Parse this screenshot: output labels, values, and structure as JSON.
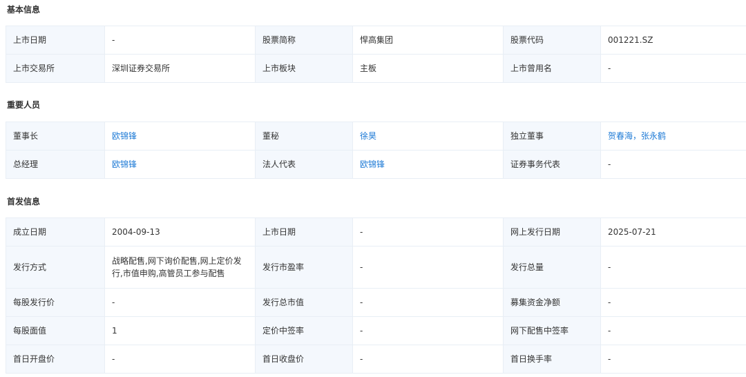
{
  "sections": {
    "basic": {
      "title": "基本信息",
      "rows": [
        [
          {
            "label": "上市日期",
            "value": "-"
          },
          {
            "label": "股票简称",
            "value": "悍高集团"
          },
          {
            "label": "股票代码",
            "value": "001221.SZ"
          }
        ],
        [
          {
            "label": "上市交易所",
            "value": "深圳证券交易所"
          },
          {
            "label": "上市板块",
            "value": "主板"
          },
          {
            "label": "上市曾用名",
            "value": "-"
          }
        ]
      ]
    },
    "people": {
      "title": "重要人员",
      "rows": [
        [
          {
            "label": "董事长",
            "value": "欧锦锋"
          },
          {
            "label": "董秘",
            "value": "徐昊"
          },
          {
            "label": "独立董事",
            "value": "贺春海，张永鹤"
          }
        ],
        [
          {
            "label": "总经理",
            "value": "欧锦锋"
          },
          {
            "label": "法人代表",
            "value": "欧锦锋"
          },
          {
            "label": "证券事务代表",
            "value": "-"
          }
        ]
      ]
    },
    "ipo": {
      "title": "首发信息",
      "rows": [
        [
          {
            "label": "成立日期",
            "value": "2004-09-13"
          },
          {
            "label": "上市日期",
            "value": "-"
          },
          {
            "label": "网上发行日期",
            "value": "2025-07-21"
          }
        ],
        [
          {
            "label": "发行方式",
            "value": "战略配售,网下询价配售,网上定价发行,市值申购,高管员工参与配售"
          },
          {
            "label": "发行市盈率",
            "value": "-"
          },
          {
            "label": "发行总量",
            "value": "-"
          }
        ],
        [
          {
            "label": "每股发行价",
            "value": "-"
          },
          {
            "label": "发行总市值",
            "value": "-"
          },
          {
            "label": "募集资金净额",
            "value": "-"
          }
        ],
        [
          {
            "label": "每股面值",
            "value": "1"
          },
          {
            "label": "定价中签率",
            "value": "-"
          },
          {
            "label": "网下配售中签率",
            "value": "-"
          }
        ],
        [
          {
            "label": "首日开盘价",
            "value": "-"
          },
          {
            "label": "首日收盘价",
            "value": "-"
          },
          {
            "label": "首日换手率",
            "value": "-"
          }
        ]
      ]
    }
  },
  "colors": {
    "label_bg": "#f4f8fd",
    "border": "#e8eef5",
    "link": "#1f7bd6",
    "text": "#333333"
  }
}
